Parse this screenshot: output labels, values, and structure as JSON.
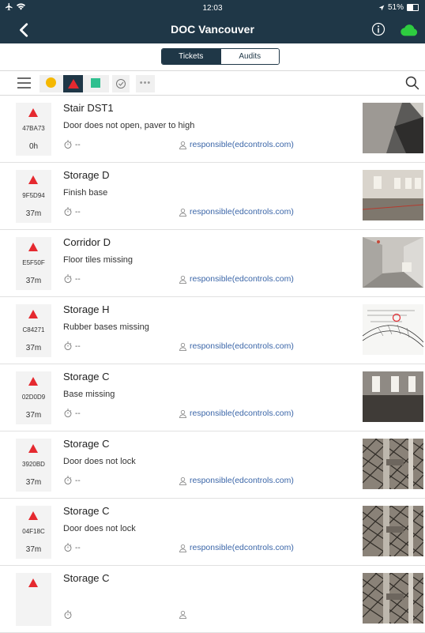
{
  "statusbar": {
    "time": "12:03",
    "battery": "51%"
  },
  "navbar": {
    "title": "DOC Vancouver"
  },
  "segments": {
    "tickets": "Tickets",
    "audits": "Audits"
  },
  "toolbar": {
    "more": "•••"
  },
  "tickets": [
    {
      "title": "Stair DST1",
      "desc": "Door does not open, paver to high",
      "code": "47BA73",
      "age": "0h",
      "timer": "--",
      "responsible": "responsible(edcontrols.com)",
      "photo": "stair"
    },
    {
      "title": "Storage D",
      "desc": "Finish base",
      "code": "9F5D94",
      "age": "37m",
      "timer": "--",
      "responsible": "responsible(edcontrols.com)",
      "photo": "room"
    },
    {
      "title": "Corridor D",
      "desc": "Floor tiles missing",
      "code": "E5F50F",
      "age": "37m",
      "timer": "--",
      "responsible": "responsible(edcontrols.com)",
      "photo": "corridor"
    },
    {
      "title": "Storage H",
      "desc": "Rubber bases missing",
      "code": "C84271",
      "age": "37m",
      "timer": "--",
      "responsible": "responsible(edcontrols.com)",
      "photo": "plan"
    },
    {
      "title": "Storage C",
      "desc": "Base missing",
      "code": "02D0D9",
      "age": "37m",
      "timer": "--",
      "responsible": "responsible(edcontrols.com)",
      "photo": "room2"
    },
    {
      "title": "Storage C",
      "desc": "Door does not lock",
      "code": "3920BD",
      "age": "37m",
      "timer": "--",
      "responsible": "responsible(edcontrols.com)",
      "photo": "gate"
    },
    {
      "title": "Storage C",
      "desc": "Door does not lock",
      "code": "04F18C",
      "age": "37m",
      "timer": "--",
      "responsible": "responsible(edcontrols.com)",
      "photo": "gate"
    },
    {
      "title": "Storage C",
      "desc": "",
      "code": "",
      "age": "",
      "timer": "",
      "responsible": "",
      "photo": "gate"
    }
  ]
}
